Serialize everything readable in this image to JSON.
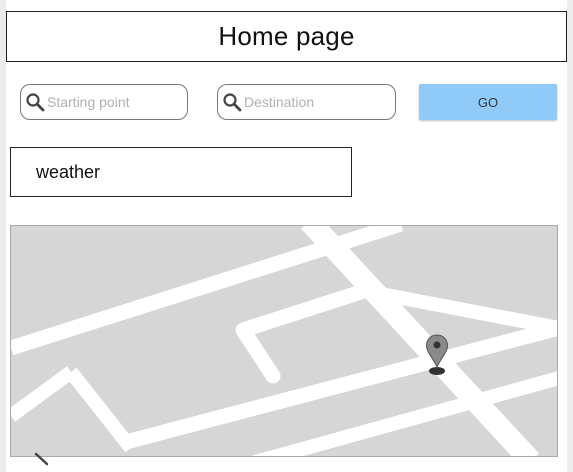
{
  "header": {
    "title": "Home page"
  },
  "search": {
    "starting_point_placeholder": "Starting point",
    "destination_placeholder": "Destination",
    "go_label": "GO"
  },
  "weather": {
    "label": "weather"
  },
  "map": {
    "marker_icon": "map-pin-icon"
  },
  "colors": {
    "go_button": "#90caf9",
    "map_background": "#d6d6d6",
    "road": "#ffffff"
  }
}
